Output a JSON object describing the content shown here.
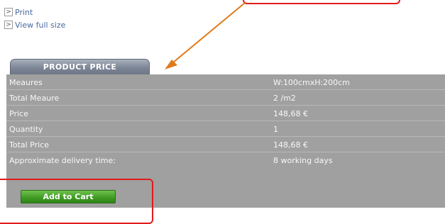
{
  "links": [
    {
      "icon": ">",
      "label": "Print"
    },
    {
      "icon": ">",
      "label": "View full size"
    }
  ],
  "price_tab": {
    "title": "PRODUCT PRICE"
  },
  "rows": [
    {
      "label": "Meaures",
      "value": "W:100cmxH:200cm"
    },
    {
      "label": "Total Meaure",
      "value": "2 /m2"
    },
    {
      "label": "Price",
      "value": "148,68 €"
    },
    {
      "label": "Quantity",
      "value": "1"
    },
    {
      "label": "Total Price",
      "value": "148,68 €"
    },
    {
      "label": "Approximate delivery time:",
      "value": "8 working days"
    }
  ],
  "add_to_cart": {
    "label": "Add to Cart"
  },
  "colors": {
    "annotation_red": "#e21a1a",
    "arrow_orange": "#e07a1a",
    "panel_gray": "#a0a0a0",
    "cart_green": "#3f9a23"
  }
}
